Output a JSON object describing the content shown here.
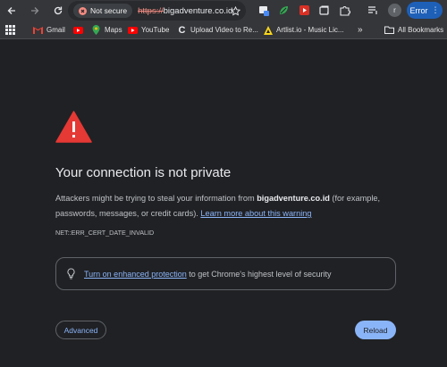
{
  "browser": {
    "security_chip": "Not secure",
    "url_scheme": "https://",
    "url_host": "bigadventure.co.id",
    "error_button": "Error",
    "avatar_initial": "r"
  },
  "bookmarks": {
    "items": [
      {
        "label": "Gmail"
      },
      {
        "label": ""
      },
      {
        "label": "Maps"
      },
      {
        "label": "YouTube"
      },
      {
        "label": "Upload Video to Re..."
      },
      {
        "label": "Artlist.io - Music Lic..."
      },
      {
        "label": "All Bookmarks"
      }
    ]
  },
  "page": {
    "title": "Your connection is not private",
    "para_1": "Attackers might be trying to steal your information from ",
    "para_host": "bigadventure.co.id",
    "para_2": " (for example, passwords, messages, or credit cards). ",
    "learn_more": "Learn more about this warning",
    "error_code": "NET::ERR_CERT_DATE_INVALID",
    "protect_link": "Turn on enhanced protection",
    "protect_rest": " to get Chrome's highest level of security",
    "advanced_button": "Advanced",
    "reload_button": "Reload"
  },
  "colors": {
    "background": "#202124",
    "warning_red": "#e53935",
    "link_blue": "#8ab4f8",
    "toolbar": "#35363a"
  }
}
